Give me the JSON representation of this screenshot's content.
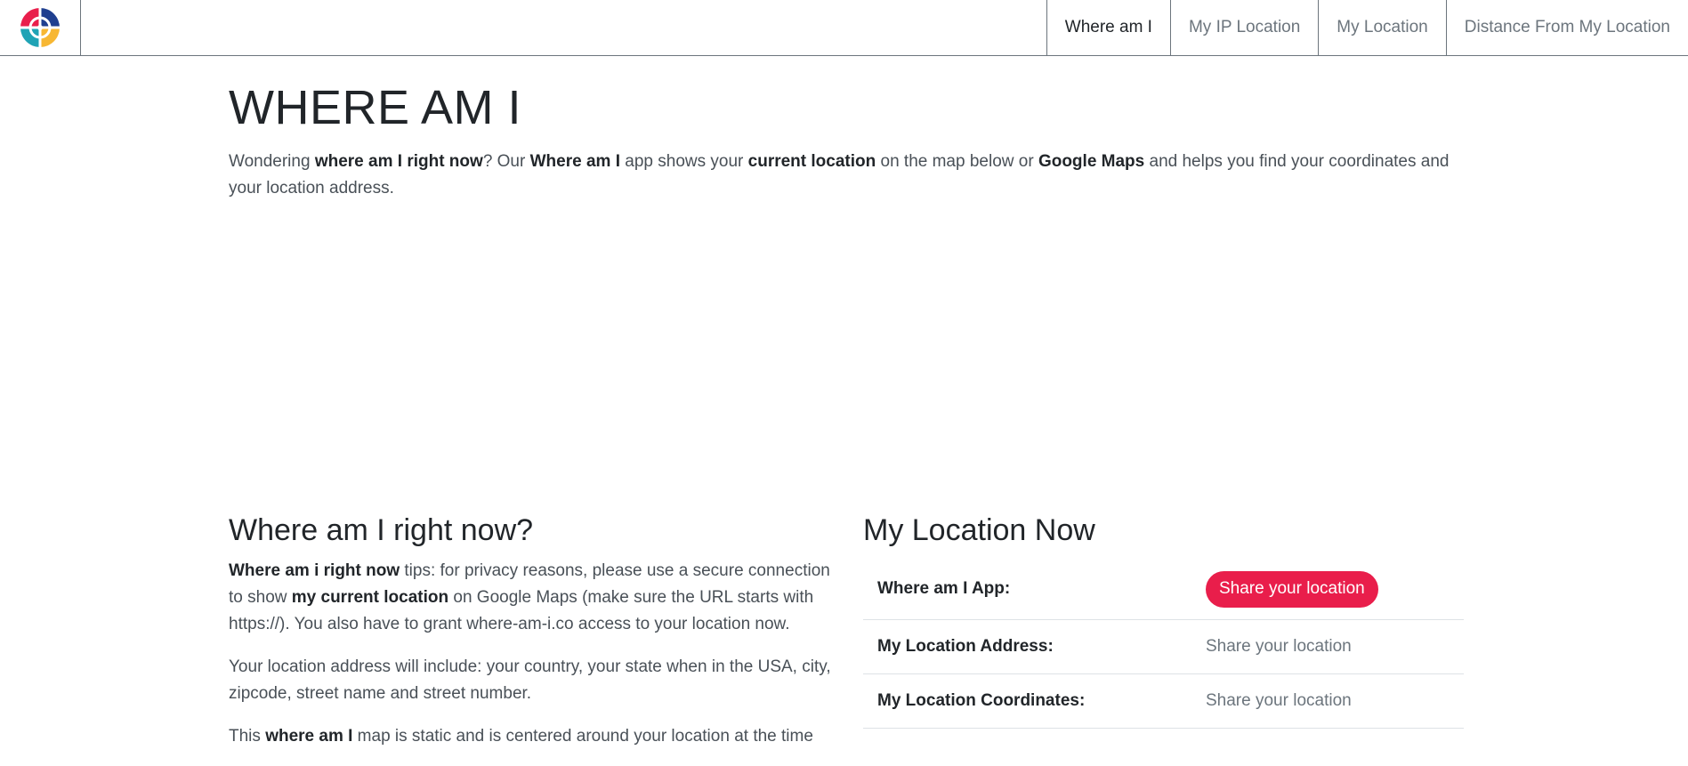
{
  "nav": {
    "items": [
      {
        "label": "Where am I",
        "active": true
      },
      {
        "label": "My IP Location",
        "active": false
      },
      {
        "label": "My Location",
        "active": false
      },
      {
        "label": "Distance From My Location",
        "active": false
      }
    ]
  },
  "header": {
    "title": "WHERE AM I"
  },
  "intro": {
    "p1": "Wondering ",
    "b1": "where am I right now",
    "p2": "? Our ",
    "b2": "Where am I",
    "p3": " app shows your ",
    "b3": "current location",
    "p4": " on the map below or ",
    "b4": "Google Maps",
    "p5": " and helps you find your coordinates and your location address."
  },
  "left": {
    "heading": "Where am I right now?",
    "para1": {
      "b1": "Where am i right now",
      "t1": " tips: for privacy reasons, please use a secure connection to show ",
      "b2": "my current location",
      "t2": " on Google Maps (make sure the URL starts with https://). You also have to grant where-am-i.co access to your location now."
    },
    "para2": "Your location address will include: your country, your state when in the USA, city, zipcode, street name and street number.",
    "para3": {
      "t1": "This ",
      "b1": "where am I",
      "t2": " map is static and is centered around your location at the time"
    }
  },
  "right": {
    "heading": "My Location Now",
    "rows": [
      {
        "label": "Where am I App:",
        "value": "Share your location"
      },
      {
        "label": "My Location Address:",
        "value": "Share your location"
      },
      {
        "label": "My Location Coordinates:",
        "value": "Share your location"
      }
    ]
  },
  "colors": {
    "accent": "#e91e4b",
    "logo_blue": "#1f3f8f",
    "logo_red": "#e91e4b",
    "logo_teal": "#1fa3b5",
    "logo_yellow": "#f7b733"
  }
}
